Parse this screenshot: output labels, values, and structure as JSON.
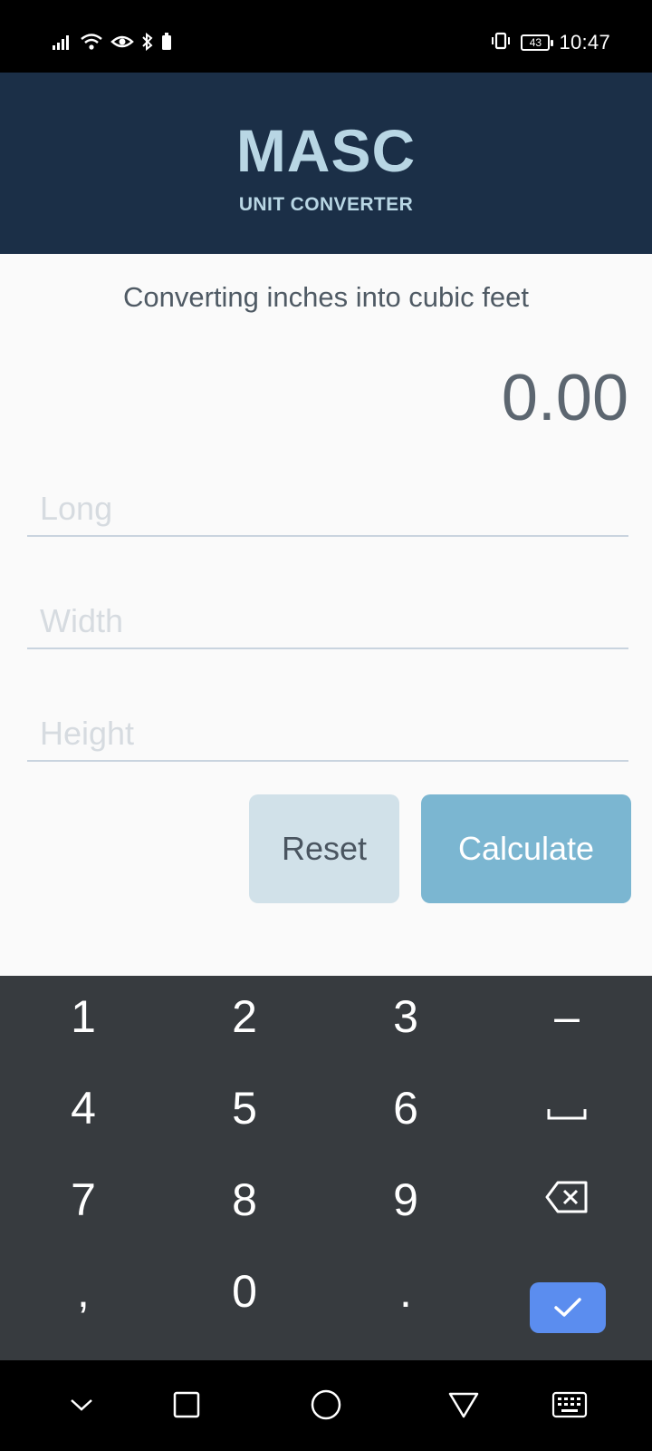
{
  "status": {
    "time": "10:47",
    "battery": "43"
  },
  "header": {
    "title": "MASC",
    "subtitle": "UNIT CONVERTER"
  },
  "main": {
    "description": "Converting inches into cubic feet",
    "result": "0.00",
    "fields": {
      "long": {
        "placeholder": "Long",
        "value": ""
      },
      "width": {
        "placeholder": "Width",
        "value": ""
      },
      "height": {
        "placeholder": "Height",
        "value": ""
      }
    },
    "buttons": {
      "reset": "Reset",
      "calculate": "Calculate"
    }
  },
  "keyboard": {
    "keys": [
      "1",
      "2",
      "3",
      "–",
      "4",
      "5",
      "6",
      "␣",
      "7",
      "8",
      "9",
      "⌫",
      ",",
      "0",
      "."
    ],
    "icons": {
      "space": "space-bar-icon",
      "backspace": "backspace-icon",
      "done": "checkmark-icon"
    }
  },
  "navigation": {
    "icons": [
      "keyboard-hide-icon",
      "recent-apps-icon",
      "home-icon",
      "back-icon",
      "keyboard-switch-icon"
    ]
  },
  "colors": {
    "header_bg": "#1b2f47",
    "header_text": "#b8d6e4",
    "reset_bg": "#d1e1e9",
    "calculate_bg": "#7bb6d1",
    "keyboard_bg": "#373b3f",
    "done_key": "#5b8def"
  }
}
